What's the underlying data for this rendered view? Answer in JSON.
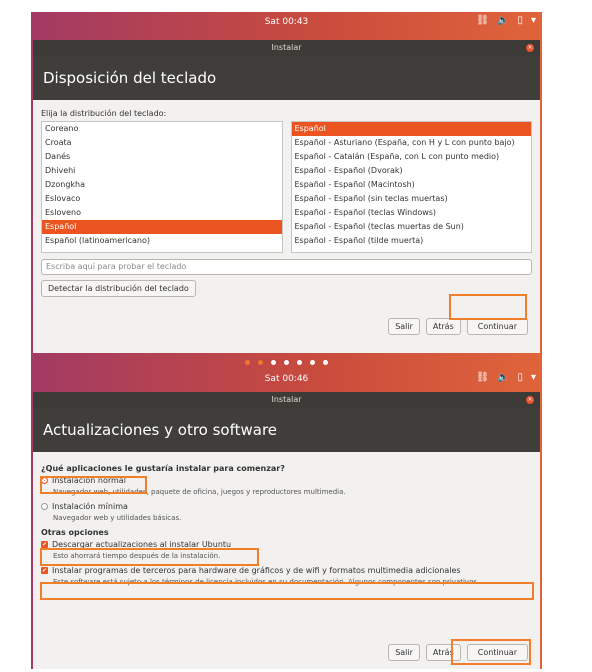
{
  "screen1": {
    "topbar": {
      "time": "Sat 00:43"
    },
    "window": {
      "title": "Instalar"
    },
    "header": {
      "title": "Disposición del teclado"
    },
    "label": "Elija la distribución del teclado:",
    "layouts": [
      "Coreano",
      "Croata",
      "Danés",
      "Dhivehi",
      "Dzongkha",
      "Eslovaco",
      "Esloveno",
      "Español",
      "Español (latinoamericano)"
    ],
    "variants": [
      "Español",
      "Español - Asturiano (España, con H y L con punto bajo)",
      "Español - Catalán (España, con L con punto medio)",
      "Español - Español (Dvorak)",
      "Español - Español (Macintosh)",
      "Español - Español (sin teclas muertas)",
      "Español - Español (teclas Windows)",
      "Español - Español (teclas muertas de Sun)",
      "Español - Español (tilde muerta)"
    ],
    "test_placeholder": "Escriba aquí para probar el teclado",
    "detect_button": "Detectar la distribución del teclado",
    "buttons": {
      "quit": "Salir",
      "back": "Atrás",
      "continue": "Continuar"
    },
    "pager_active": 2
  },
  "screen2": {
    "topbar": {
      "time": "Sat 00:46"
    },
    "window": {
      "title": "Instalar"
    },
    "header": {
      "title": "Actualizaciones y otro software"
    },
    "question": "¿Qué aplicaciones le gustaría instalar para comenzar?",
    "options": [
      {
        "label": "Instalación normal",
        "desc": "Navegador web, utilidades, paquete de oficina, juegos y reproductores multimedia."
      },
      {
        "label": "Instalación mínima",
        "desc": "Navegador web y utilidades básicas."
      }
    ],
    "others_title": "Otras opciones",
    "checks": [
      {
        "label": "Descargar actualizaciones al instalar Ubuntu",
        "desc": "Esto ahorrará tiempo después de la instalación."
      },
      {
        "label": "Instalar programas de terceros para hardware de gráficos y de wifi y formatos multimedia adicionales",
        "desc": "Este software está sujeto a los términos de licencia incluidos en su documentación. Algunos componentes son privativos."
      }
    ],
    "buttons": {
      "quit": "Salir",
      "back": "Atrás",
      "continue": "Continuar"
    }
  },
  "colors": {
    "accent": "#E95420",
    "highlight": "#F07F2B"
  },
  "icons": [
    "network-icon",
    "volume-icon",
    "battery-icon",
    "chevron-down-icon",
    "close-icon"
  ]
}
